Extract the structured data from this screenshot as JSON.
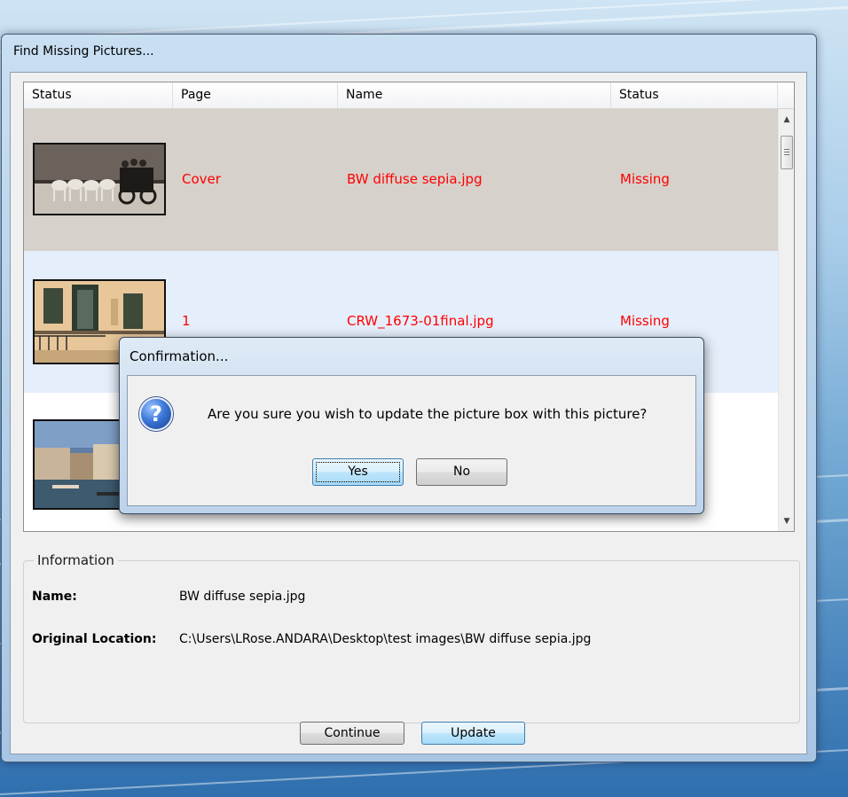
{
  "main_window": {
    "title": "Find Missing Pictures...",
    "columns": [
      "Status",
      "Page",
      "Name",
      "Status"
    ],
    "rows": [
      {
        "page": "Cover",
        "name": "BW diffuse sepia.jpg",
        "status": "Missing",
        "thumbnail": "sepia-horses-carriage",
        "selected": true
      },
      {
        "page": "1",
        "name": "CRW_1673-01final.jpg",
        "status": "Missing",
        "thumbnail": "balcony-windows",
        "selected": false
      },
      {
        "page": "",
        "name": "",
        "status": "",
        "thumbnail": "venice-canal",
        "selected": false
      }
    ],
    "information": {
      "legend": "Information",
      "name_label": "Name:",
      "name_value": "BW diffuse sepia.jpg",
      "location_label": "Original Location:",
      "location_value": "C:\\Users\\LRose.ANDARA\\Desktop\\test images\\BW diffuse sepia.jpg"
    },
    "buttons": {
      "continue": "Continue",
      "update": "Update"
    }
  },
  "confirmation": {
    "title": "Confirmation...",
    "icon": "question-icon",
    "message": "Are you sure you wish to update the picture box with this picture?",
    "buttons": {
      "yes": "Yes",
      "no": "No"
    }
  },
  "colors": {
    "missing_text": "#ff0000",
    "selected_row": "#d6d1cb",
    "alt_row": "#e5eefb"
  }
}
